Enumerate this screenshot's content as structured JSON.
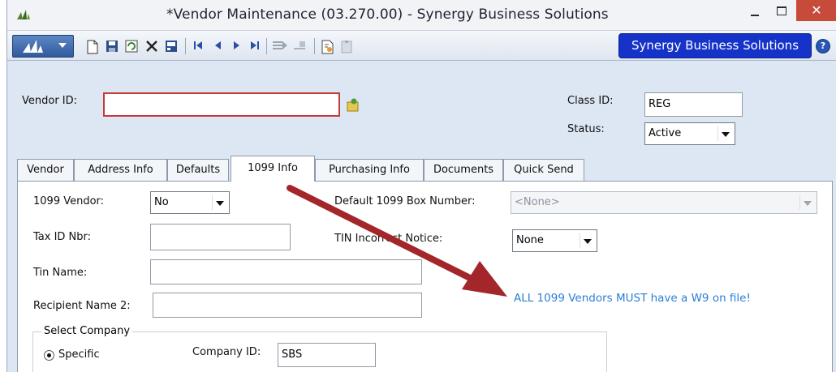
{
  "window": {
    "title": "*Vendor Maintenance (03.270.00) - Synergy Business Solutions",
    "close_glyph": "✕"
  },
  "toolbar": {
    "company_button": "Synergy Business Solutions",
    "help_glyph": "?",
    "icons": [
      "new-icon",
      "save-icon",
      "refresh-icon",
      "delete-icon",
      "print-icon",
      "first-record-icon",
      "previous-record-icon",
      "next-record-icon",
      "last-record-icon",
      "copy-icon",
      "paste-icon",
      "report-icon",
      "notes-icon"
    ]
  },
  "header": {
    "vendor_id_label": "Vendor ID:",
    "vendor_id_value": "",
    "class_id_label": "Class ID:",
    "class_id_value": "REG",
    "status_label": "Status:",
    "status_value": "Active"
  },
  "tabs": [
    {
      "label": "Vendor",
      "active": false
    },
    {
      "label": "Address Info",
      "active": false
    },
    {
      "label": "Defaults",
      "active": false
    },
    {
      "label": "1099 Info",
      "active": true
    },
    {
      "label": "Purchasing Info",
      "active": false
    },
    {
      "label": "Documents",
      "active": false
    },
    {
      "label": "Quick Send",
      "active": false
    }
  ],
  "form": {
    "vendor_1099_label": "1099 Vendor:",
    "vendor_1099_value": "No",
    "default_box_label": "Default 1099 Box Number:",
    "default_box_value": "<None>",
    "tax_id_label": "Tax ID Nbr:",
    "tax_id_value": "",
    "tin_incorrect_label": "TIN Incorrect Notice:",
    "tin_incorrect_value": "None",
    "tin_name_label": "Tin Name:",
    "tin_name_value": "",
    "recipient_name2_label": "Recipient Name 2:",
    "recipient_name2_value": "",
    "select_company_label": "Select Company",
    "specific_label": "Specific",
    "company_id_label": "Company ID:",
    "company_id_value": "SBS"
  },
  "annotation": {
    "note": "ALL 1099 Vendors MUST have a W9 on file!",
    "arrow_color": "#a3262b"
  }
}
